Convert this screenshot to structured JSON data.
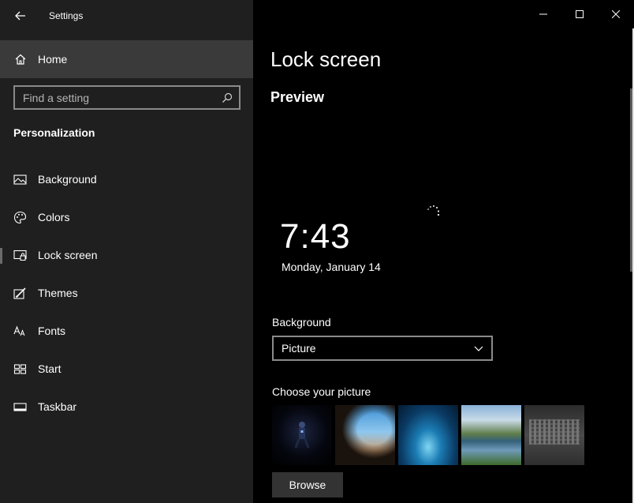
{
  "window": {
    "title": "Settings",
    "controls": [
      "minimize-icon",
      "maximize-icon",
      "close-icon"
    ]
  },
  "sidebar": {
    "home_label": "Home",
    "search_placeholder": "Find a setting",
    "section_title": "Personalization",
    "items": [
      {
        "label": "Background",
        "icon": "image-icon"
      },
      {
        "label": "Colors",
        "icon": "palette-icon"
      },
      {
        "label": "Lock screen",
        "icon": "lock-screen-icon",
        "selected": true
      },
      {
        "label": "Themes",
        "icon": "themes-brush-icon"
      },
      {
        "label": "Fonts",
        "icon": "font-icon"
      },
      {
        "label": "Start",
        "icon": "start-tiles-icon"
      },
      {
        "label": "Taskbar",
        "icon": "taskbar-icon"
      }
    ]
  },
  "main": {
    "page_title": "Lock screen",
    "preview_title": "Preview",
    "preview": {
      "time": "7:43",
      "date": "Monday, January 14"
    },
    "background": {
      "label": "Background",
      "selected": "Picture"
    },
    "choose_picture_label": "Choose your picture",
    "thumbnails": [
      "dark-figure-thumbnail",
      "beach-cave-thumbnail",
      "ice-cave-thumbnail",
      "mountain-lake-thumbnail",
      "grey-texture-thumbnail"
    ],
    "browse_label": "Browse"
  },
  "colors": {
    "sidebar_bg": "#1f1f1f",
    "selected_bg": "#3a3a3a",
    "main_bg": "#000000",
    "button_bg": "#333333"
  }
}
